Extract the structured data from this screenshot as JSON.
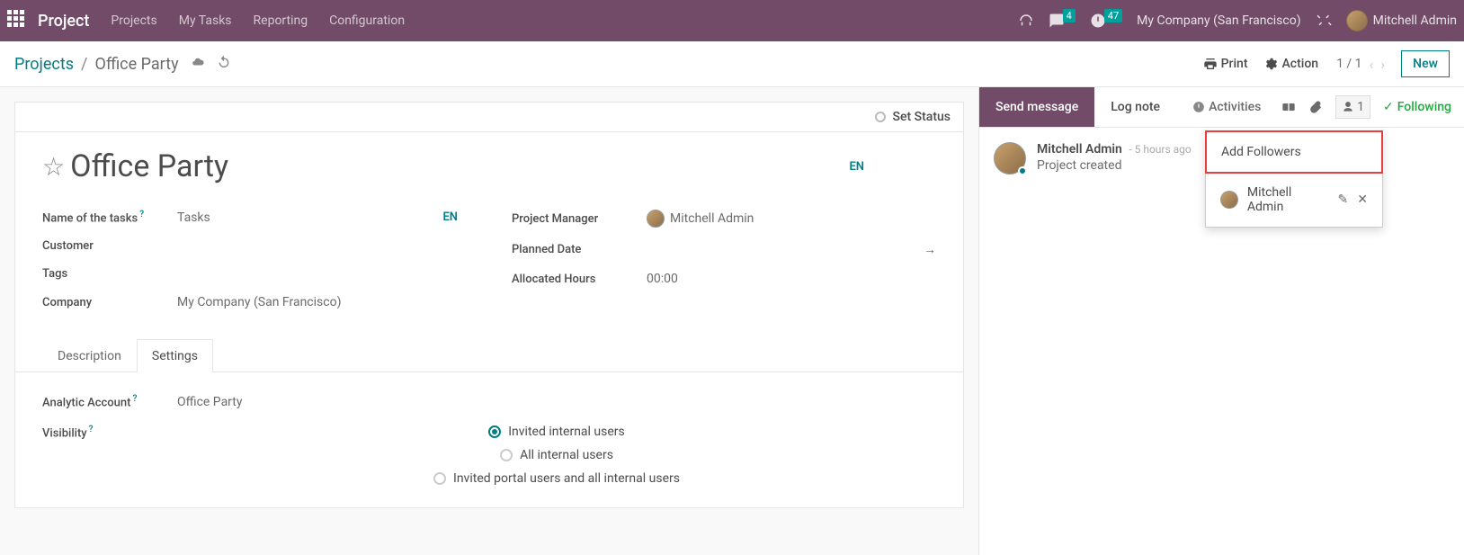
{
  "topnav": {
    "app_title": "Project",
    "links": [
      "Projects",
      "My Tasks",
      "Reporting",
      "Configuration"
    ],
    "messaging_badge": "4",
    "activities_badge": "47",
    "company": "My Company (San Francisco)",
    "username": "Mitchell Admin"
  },
  "controlbar": {
    "breadcrumb_root": "Projects",
    "breadcrumb_current": "Office Party",
    "print_label": "Print",
    "action_label": "Action",
    "pager": "1 / 1",
    "new_label": "New"
  },
  "form": {
    "set_status_label": "Set Status",
    "title": "Office Party",
    "lang_badge": "EN",
    "fields": {
      "tasks_label": "Name of the tasks",
      "tasks_value": "Tasks",
      "tasks_lang": "EN",
      "customer_label": "Customer",
      "tags_label": "Tags",
      "company_label": "Company",
      "company_value": "My Company (San Francisco)",
      "pm_label": "Project Manager",
      "pm_value": "Mitchell Admin",
      "planned_label": "Planned Date",
      "alloc_label": "Allocated Hours",
      "alloc_value": "00:00"
    },
    "tabs": {
      "description": "Description",
      "settings": "Settings"
    },
    "settings": {
      "analytic_label": "Analytic Account",
      "analytic_value": "Office Party",
      "visibility_label": "Visibility",
      "visibility_options": [
        "Invited internal users",
        "All internal users",
        "Invited portal users and all internal users"
      ],
      "visibility_selected": 0
    }
  },
  "chatter": {
    "send_message": "Send message",
    "log_note": "Log note",
    "activities": "Activities",
    "follower_count": "1",
    "following": "Following",
    "popover": {
      "add_followers": "Add Followers",
      "follower_name": "Mitchell Admin"
    },
    "message": {
      "author": "Mitchell Admin",
      "time": "- 5 hours ago",
      "text": "Project created"
    }
  }
}
